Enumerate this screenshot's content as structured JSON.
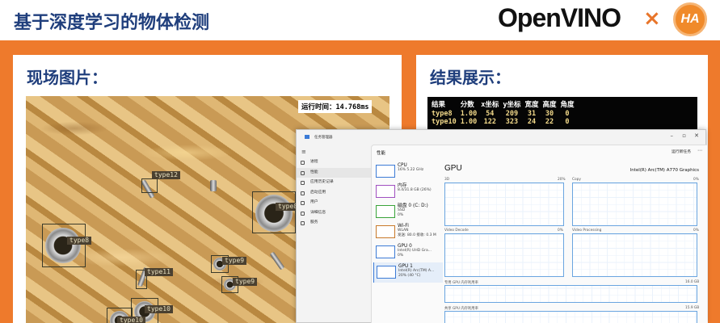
{
  "header": {
    "title": "基于深度学习的物体检测",
    "logo": "OpenVINO",
    "times": "×",
    "ha": "HA"
  },
  "left_panel": {
    "title": "现场图片：",
    "runtime": "运行时间：14.768ms",
    "detections": [
      "type12",
      "type8",
      "type8",
      "type9",
      "type9",
      "type11",
      "type10",
      "type10"
    ]
  },
  "right_panel": {
    "title": "结果展示：",
    "columns": [
      "结果",
      "分数",
      "x坐标",
      "y坐标",
      "宽度",
      "高度",
      "角度"
    ],
    "rows": [
      [
        "type8",
        "1.00",
        "54",
        "209",
        "31",
        "30",
        "0"
      ],
      [
        "type10",
        "1.00",
        "122",
        "323",
        "24",
        "22",
        "0"
      ]
    ]
  },
  "task_manager": {
    "window_title": "任务管理器",
    "nav": [
      "进程",
      "性能",
      "应用历史记录",
      "启动应用",
      "用户",
      "详细信息",
      "服务"
    ],
    "active_nav": 1,
    "header": "性能",
    "run_task": "运行新任务",
    "resources": [
      {
        "name": "CPU",
        "sub": "16% 5.22 GHz",
        "sub2": ""
      },
      {
        "name": "内存",
        "sub": "8.4/31.8 GB (26%)",
        "sub2": ""
      },
      {
        "name": "磁盘 0 (C: D:)",
        "sub": "SSD",
        "sub2": "0%"
      },
      {
        "name": "Wi-Fi",
        "sub": "WLAN",
        "sub2": "发送: 80.0 接收: 0.3 M"
      },
      {
        "name": "GPU 0",
        "sub": "Intel(R) UHD Gra...",
        "sub2": "0%"
      },
      {
        "name": "GPU 1",
        "sub": "Intel(R) Arc(TM) A...",
        "sub2": "20% (40 °C)"
      }
    ],
    "gpu_title": "GPU",
    "gpu_model": "Intel(R) Arc(TM) A770 Graphics",
    "graphs": [
      {
        "label": "3D",
        "pct": "20%"
      },
      {
        "label": "Copy",
        "pct": "0%"
      },
      {
        "label": "Video Decode",
        "pct": "0%"
      },
      {
        "label": "Video Processing",
        "pct": "0%"
      }
    ],
    "dedicated_label": "专用 GPU 内存利用率",
    "dedicated_value": "16.0 GB",
    "shared_label": "共享 GPU 内存利用率",
    "shared_value": "15.9 GB"
  }
}
